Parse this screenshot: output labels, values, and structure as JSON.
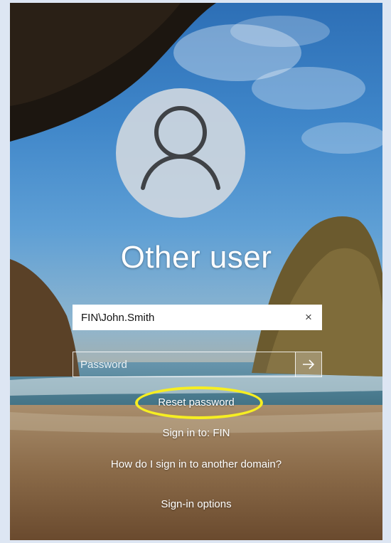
{
  "login": {
    "username": "Other user",
    "username_value": "FIN\\John.Smith",
    "clear_glyph": "×",
    "password_placeholder": "Password",
    "reset_password": "Reset password",
    "sign_in_to": "Sign in to: FIN",
    "other_domain": "How do I sign in to another domain?",
    "sign_in_options": "Sign-in options"
  },
  "icons": {
    "avatar": "user-silhouette-icon",
    "submit": "arrow-right-icon",
    "clear": "close-icon"
  },
  "colors": {
    "highlight": "#f6ee22",
    "text": "#ffffff"
  }
}
